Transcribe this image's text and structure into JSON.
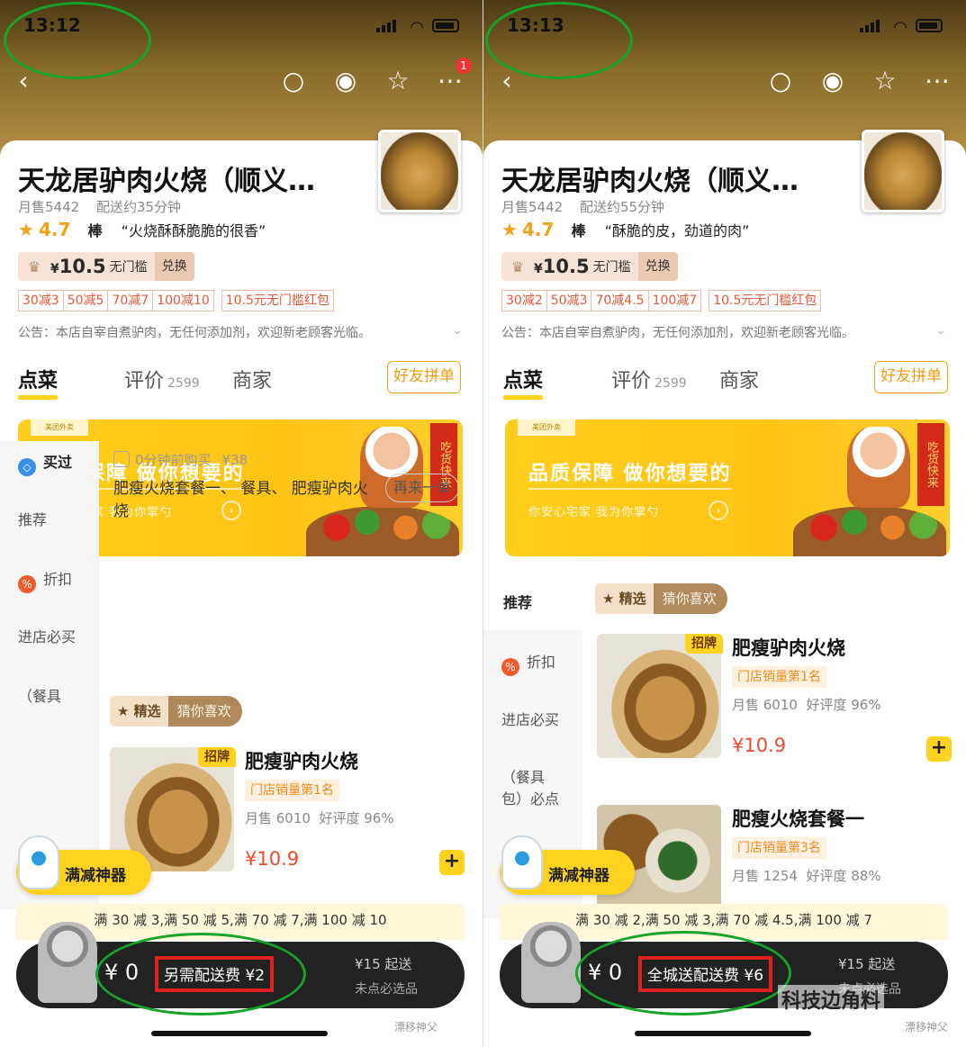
{
  "screens": [
    {
      "time": "13:12",
      "badge": "1",
      "shop_name": "天龙居驴肉火烧（顺义…",
      "monthly_sales": "月售5442",
      "delivery_time": "配送约35分钟",
      "rating": "4.7",
      "rating_word": "棒",
      "review_quote": "“火烧酥酥脆脆的很香”",
      "coupon_amount": "10.5",
      "coupon_currency": "¥",
      "coupon_threshold": "无门槛",
      "coupon_exchange": "兑换",
      "discounts": [
        "30减3",
        "50减5",
        "70减7",
        "100减10"
      ],
      "red_packet": "10.5元无门槛红包",
      "notice": "公告：本店自宰自煮驴肉，无任何添加剂，欢迎新老顾客光临。",
      "tabs": {
        "order": "点菜",
        "review": "评价",
        "review_count": "2599",
        "merchant": "商家",
        "group": "好友拼单"
      },
      "banner": {
        "title": "品质保障 做你想要的",
        "subtitle": "你安心宅家 我为你掌勺",
        "scroll": "吃货快来"
      },
      "sidebar": [
        "买过",
        "推荐",
        "折扣",
        "进店必买",
        "（餐具"
      ],
      "bought": {
        "time": "0分钟前购买",
        "price": "¥38",
        "items": "肥瘦火烧套餐一、 餐具、 肥瘦驴肉火烧",
        "again": "再来一单"
      },
      "pick_label": "精选",
      "guess_label": "猜你喜欢",
      "dishes": [
        {
          "sign": "招牌",
          "name": "肥瘦驴肉火烧",
          "rank": "门店销量第1名",
          "sold": "月售 6010",
          "praise": "好评度 96%",
          "price": "¥10.9"
        }
      ],
      "reduce_tool": "满减神器",
      "promo": "满 30 减 3,满 50 减 5,满 70 减 7,满 100 减 10",
      "cart_total": "¥ 0",
      "delivery_fee": "另需配送费 ¥2",
      "min_order": "¥15 起送",
      "must_pick": "未点必选品",
      "watermark": "漂移神父"
    },
    {
      "time": "13:13",
      "badge": "",
      "shop_name": "天龙居驴肉火烧（顺义…",
      "monthly_sales": "月售5442",
      "delivery_time": "配送约55分钟",
      "rating": "4.7",
      "rating_word": "棒",
      "review_quote": "“酥脆的皮，劲道的肉”",
      "coupon_amount": "10.5",
      "coupon_currency": "¥",
      "coupon_threshold": "无门槛",
      "coupon_exchange": "兑换",
      "discounts": [
        "30减2",
        "50减3",
        "70减4.5",
        "100减7"
      ],
      "red_packet": "10.5元无门槛红包",
      "notice": "公告：本店自宰自煮驴肉，无任何添加剂，欢迎新老顾客光临。",
      "tabs": {
        "order": "点菜",
        "review": "评价",
        "review_count": "2599",
        "merchant": "商家",
        "group": "好友拼单"
      },
      "banner": {
        "title": "品质保障 做你想要的",
        "subtitle": "你安心宅家 我为你掌勺",
        "scroll": "吃货快来"
      },
      "sidebar": [
        "推荐",
        "折扣",
        "进店必买",
        "（餐具包）必点"
      ],
      "pick_label": "精选",
      "guess_label": "猜你喜欢",
      "dishes": [
        {
          "sign": "招牌",
          "name": "肥瘦驴肉火烧",
          "rank": "门店销量第1名",
          "sold": "月售 6010",
          "praise": "好评度 96%",
          "price": "¥10.9"
        },
        {
          "sign": "",
          "name": "肥瘦火烧套餐一",
          "rank": "门店销量第3名",
          "sold": "月售 1254",
          "praise": "好评度 88%",
          "price": ""
        }
      ],
      "reduce_tool": "满减神器",
      "promo": "满 30 减 2,满 50 减 3,满 70 减 4.5,满 100 减 7",
      "cart_total": "¥ 0",
      "delivery_fee": "全城送配送费 ¥6",
      "min_order": "¥15 起送",
      "must_pick": "未点必选品",
      "watermark": "漂移神父",
      "channel_watermark": "科技边角料"
    }
  ],
  "colors": {
    "accent": "#ffd21f",
    "rating": "#f2a417",
    "price": "#f04a2a",
    "highlight_box": "#e02020",
    "annotation_oval": "#15a32a"
  }
}
